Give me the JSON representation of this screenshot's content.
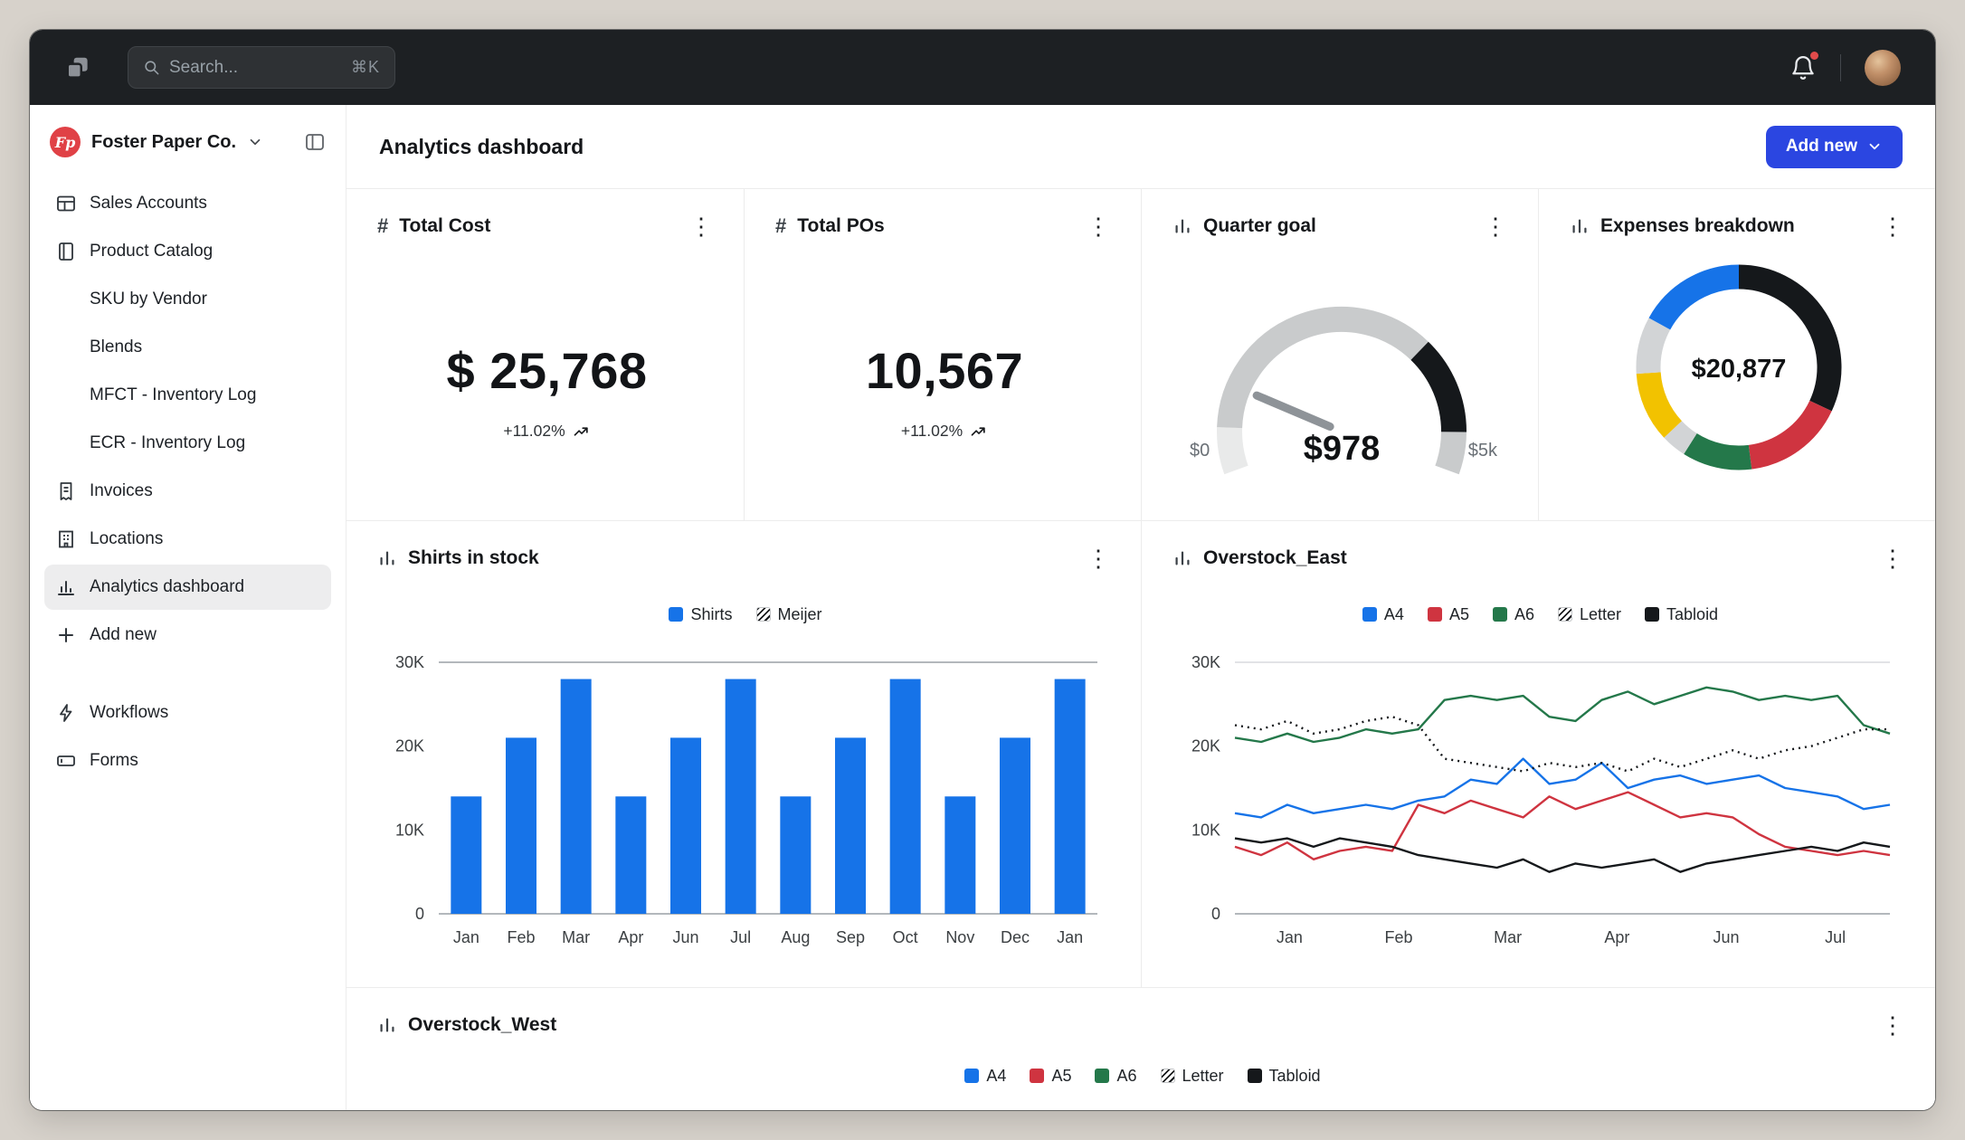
{
  "icons": {
    "kebab": "⋮",
    "hash": "#"
  },
  "topbar": {
    "search_placeholder": "Search...",
    "search_shortcut": "⌘K"
  },
  "sidebar": {
    "company": "Foster Paper Co.",
    "logo_text": "Fp",
    "items": [
      {
        "label": "Sales Accounts"
      },
      {
        "label": "Product Catalog"
      },
      {
        "label": "SKU by Vendor"
      },
      {
        "label": "Blends"
      },
      {
        "label": "MFCT - Inventory Log"
      },
      {
        "label": "ECR - Inventory Log"
      },
      {
        "label": "Invoices"
      },
      {
        "label": "Locations"
      },
      {
        "label": "Analytics dashboard"
      },
      {
        "label": "Add new"
      }
    ],
    "footer_items": [
      {
        "label": "Workflows"
      },
      {
        "label": "Forms"
      }
    ]
  },
  "header": {
    "title": "Analytics dashboard",
    "add_new": "Add new"
  },
  "stats": {
    "total_cost": {
      "title": "Total Cost",
      "value": "$ 25,768",
      "delta": "+11.02%"
    },
    "total_pos": {
      "title": "Total POs",
      "value": "10,567",
      "delta": "+11.02%"
    }
  },
  "gauge": {
    "title": "Quarter goal",
    "min_label": "$0",
    "max_label": "$5k",
    "value_label": "$978",
    "value": 978,
    "max": 5000,
    "start_angle": 200,
    "sweep": 220,
    "needle_color": "#8e9398",
    "segments": [
      {
        "color": "#e9eaea",
        "frac": 0.1
      },
      {
        "color": "#c9cbcc",
        "frac": 0.6
      },
      {
        "color": "#15181b",
        "frac": 0.21
      },
      {
        "color": "#c9cbcc",
        "frac": 0.09
      }
    ]
  },
  "donut": {
    "title": "Expenses breakdown",
    "center_label": "$20,877",
    "segments": [
      {
        "color": "#15181b",
        "frac": 0.32
      },
      {
        "color": "#cf3440",
        "frac": 0.16
      },
      {
        "color": "#24784a",
        "frac": 0.11
      },
      {
        "color": "#d2d4d6",
        "frac": 0.04
      },
      {
        "color": "#f2c200",
        "frac": 0.11
      },
      {
        "color": "#d2d4d6",
        "frac": 0.09
      },
      {
        "color": "#1673e8",
        "frac": 0.17
      }
    ]
  },
  "chart_data": [
    {
      "type": "bar",
      "title": "Shirts in stock",
      "legend": [
        {
          "label": "Shirts",
          "swatch": "#1673e8"
        },
        {
          "label": "Meijer",
          "swatch": "hatch"
        }
      ],
      "categories": [
        "Jan",
        "Feb",
        "Mar",
        "Apr",
        "Jun",
        "Jul",
        "Aug",
        "Sep",
        "Oct",
        "Nov",
        "Dec",
        "Jan"
      ],
      "values": [
        14000,
        21000,
        28000,
        14000,
        21000,
        28000,
        14000,
        21000,
        28000,
        14000,
        21000,
        28000
      ],
      "bar_color": "#1673e8",
      "ylim": [
        0,
        30000
      ],
      "yticks": [
        [
          0,
          "0"
        ],
        [
          10000,
          "10K"
        ],
        [
          20000,
          "20K"
        ],
        [
          30000,
          "30K"
        ]
      ],
      "grid": "top-and-baseline",
      "legend_position": "top"
    },
    {
      "type": "line",
      "title": "Overstock_East",
      "legend": [
        {
          "label": "A4",
          "swatch": "#1673e8"
        },
        {
          "label": "A5",
          "swatch": "#cf3440"
        },
        {
          "label": "A6",
          "swatch": "#24784a"
        },
        {
          "label": "Letter",
          "swatch": "hatch"
        },
        {
          "label": "Tabloid",
          "swatch": "#15181b"
        }
      ],
      "xticks": [
        "Jan",
        "Feb",
        "Mar",
        "Apr",
        "Jun",
        "Jul"
      ],
      "ylim": [
        0,
        30000
      ],
      "yticks": [
        [
          0,
          "0"
        ],
        [
          10000,
          "10K"
        ],
        [
          20000,
          "20K"
        ],
        [
          30000,
          "30K"
        ]
      ],
      "legend_position": "top",
      "series": [
        {
          "name": "A4",
          "color": "#1673e8",
          "dash": null,
          "values": [
            12000,
            11500,
            13000,
            12000,
            12500,
            13000,
            12500,
            13500,
            14000,
            16000,
            15500,
            18500,
            15500,
            16000,
            18000,
            15000,
            16000,
            16500,
            15500,
            16000,
            16500,
            15000,
            14500,
            14000,
            12500,
            13000
          ]
        },
        {
          "name": "A5",
          "color": "#cf3440",
          "dash": null,
          "values": [
            8000,
            7000,
            8500,
            6500,
            7500,
            8000,
            7500,
            13000,
            12000,
            13500,
            12500,
            11500,
            14000,
            12500,
            13500,
            14500,
            13000,
            11500,
            12000,
            11500,
            9500,
            8000,
            7500,
            7000,
            7500,
            7000
          ]
        },
        {
          "name": "A6",
          "color": "#24784a",
          "dash": null,
          "values": [
            21000,
            20500,
            21500,
            20500,
            21000,
            22000,
            21500,
            22000,
            25500,
            26000,
            25500,
            26000,
            23500,
            23000,
            25500,
            26500,
            25000,
            26000,
            27000,
            26500,
            25500,
            26000,
            25500,
            26000,
            22500,
            21500
          ]
        },
        {
          "name": "Letter",
          "color": "#15181b",
          "dash": "2 5",
          "values": [
            22500,
            22000,
            23000,
            21500,
            22000,
            23000,
            23500,
            22500,
            18500,
            18000,
            17500,
            17000,
            18000,
            17500,
            18000,
            17000,
            18500,
            17500,
            18500,
            19500,
            18500,
            19500,
            20000,
            21000,
            22000,
            22000
          ]
        },
        {
          "name": "Tabloid",
          "color": "#15181b",
          "dash": null,
          "values": [
            9000,
            8500,
            9000,
            8000,
            9000,
            8500,
            8000,
            7000,
            6500,
            6000,
            5500,
            6500,
            5000,
            6000,
            5500,
            6000,
            6500,
            5000,
            6000,
            6500,
            7000,
            7500,
            8000,
            7500,
            8500,
            8000
          ]
        }
      ]
    },
    {
      "type": "line",
      "title": "Overstock_West",
      "legend": [
        {
          "label": "A4",
          "swatch": "#1673e8"
        },
        {
          "label": "A5",
          "swatch": "#cf3440"
        },
        {
          "label": "A6",
          "swatch": "#24784a"
        },
        {
          "label": "Letter",
          "swatch": "hatch"
        },
        {
          "label": "Tabloid",
          "swatch": "#15181b"
        }
      ],
      "legend_position": "top"
    }
  ]
}
